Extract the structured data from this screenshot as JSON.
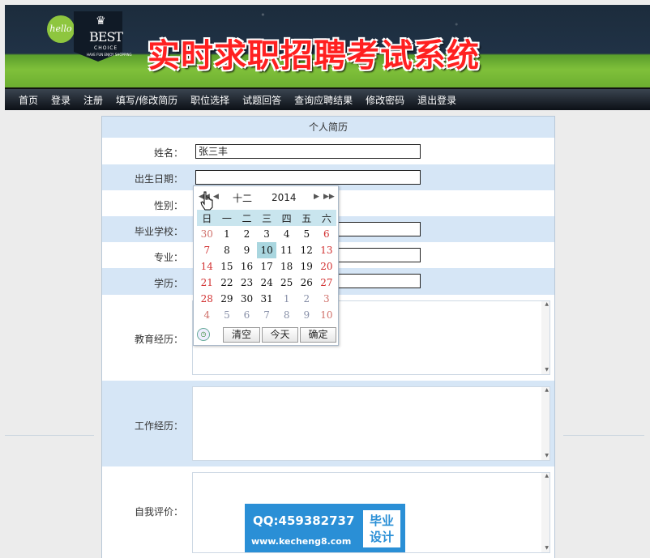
{
  "site": {
    "hello_logo": "hello",
    "brand_main": "BEST",
    "brand_sub": "CHOICE",
    "brand_tagline": "HAVE FUN ENJOY SHOPPING",
    "title": "实时求职招聘考试系统"
  },
  "nav": {
    "items": [
      "首页",
      "登录",
      "注册",
      "填写/修改简历",
      "职位选择",
      "试题回答",
      "查询应聘结果",
      "修改密码",
      "退出登录"
    ]
  },
  "form": {
    "header": "个人简历",
    "name_label": "姓名：",
    "name_value": "张三丰",
    "birth_label": "出生日期：",
    "birth_value": "",
    "gender_label": "性别：",
    "school_label": "毕业学校：",
    "major_label": "专业：",
    "degree_label": "学历：",
    "education_label": "教育经历：",
    "work_label": "工作经历：",
    "selfeval_label": "自我评价："
  },
  "calendar": {
    "month": "十二",
    "year": "2014",
    "weekdays": [
      "日",
      "一",
      "二",
      "三",
      "四",
      "五",
      "六"
    ],
    "weeks": [
      [
        "30",
        "1",
        "2",
        "3",
        "4",
        "5",
        "6"
      ],
      [
        "7",
        "8",
        "9",
        "10",
        "11",
        "12",
        "13"
      ],
      [
        "14",
        "15",
        "16",
        "17",
        "18",
        "19",
        "20"
      ],
      [
        "21",
        "22",
        "23",
        "24",
        "25",
        "26",
        "27"
      ],
      [
        "28",
        "29",
        "30",
        "31",
        "1",
        "2",
        "3"
      ],
      [
        "4",
        "5",
        "6",
        "7",
        "8",
        "9",
        "10"
      ]
    ],
    "selected_day": "10",
    "clear_label": "清空",
    "today_label": "今天",
    "ok_label": "确定"
  },
  "watermark": {
    "qq": "QQ:459382737",
    "url": "www.kecheng8.com",
    "badge_line1": "毕业",
    "badge_line2": "设计"
  }
}
